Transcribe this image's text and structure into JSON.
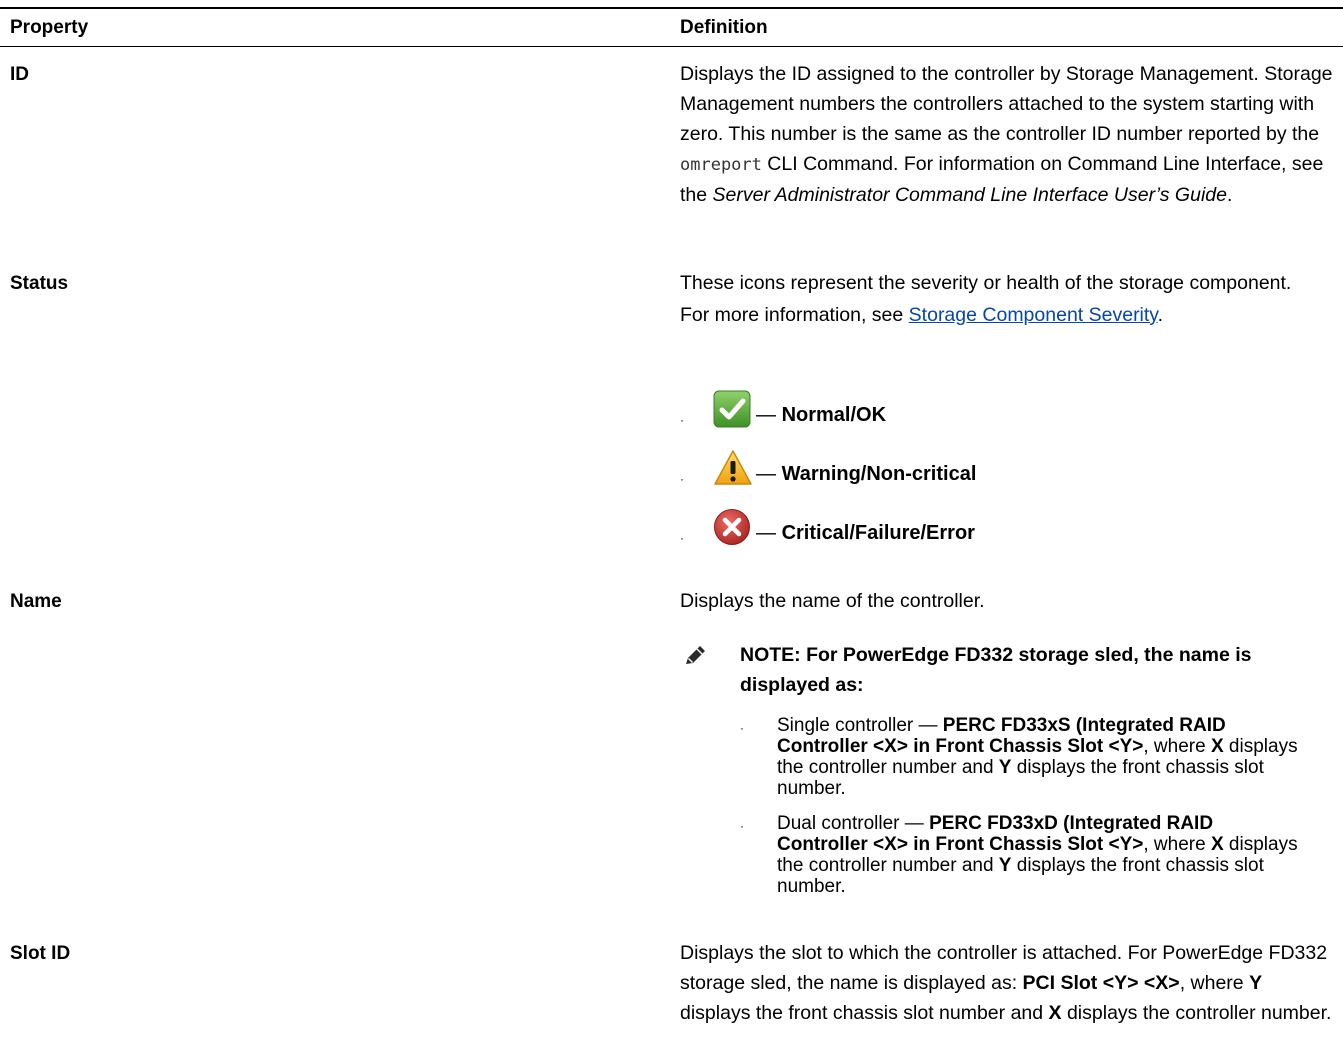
{
  "table": {
    "header": {
      "property": "Property",
      "definition": "Definition"
    },
    "rows": [
      {
        "property": "ID",
        "def_part1": "Displays the ID assigned to the controller by Storage Management. Storage Management numbers the controllers attached to the system starting with zero. This number is the same as the controller ID number reported by the ",
        "def_code": "omreport",
        "def_part2": " CLI Command. For information on Command Line Interface, see the ",
        "def_guide": "Server Administrator Command Line Interface User’s Guide",
        "def_end": "."
      },
      {
        "property": "Status",
        "def_line1": "These icons represent the severity or health of the storage component.",
        "def_line2_prefix": "For more information, see ",
        "def_link": "Storage Component Severity",
        "def_line2_suffix": ".",
        "icons": [
          {
            "icon": "check-icon",
            "dash": "—",
            "label": "Normal/OK",
            "color": "#5aa83a"
          },
          {
            "icon": "warning-icon",
            "dash": "—",
            "label": "Warning/Non-critical",
            "color": "#f2b01e"
          },
          {
            "icon": "error-icon",
            "dash": "—",
            "label": "Critical/Failure/Error",
            "color": "#c9302c"
          }
        ]
      },
      {
        "property": "Name",
        "def_line1": "Displays the name of the controller.",
        "note": "NOTE: For PowerEdge FD332 storage sled, the name is displayed as:",
        "items": [
          {
            "prefix": "Single controller — ",
            "bold1": "PERC FD33xS (Integrated RAID Controller <X> in Front Chassis Slot <Y>",
            "mid1": ", where ",
            "x": "X",
            "mid2": " displays the controller number and ",
            "y": "Y",
            "end": " displays the front chassis slot number."
          },
          {
            "prefix": "Dual controller — ",
            "bold1": "PERC FD33xD (Integrated RAID Controller <X> in Front Chassis Slot <Y>",
            "mid1": ", where ",
            "x": "X",
            "mid2": " displays the controller number and ",
            "y": "Y",
            "end": " displays the front chassis slot number."
          }
        ]
      },
      {
        "property": "Slot ID",
        "def_part1": "Displays the slot to which the controller is attached. For PowerEdge FD332 storage sled, the name is displayed as: ",
        "def_bold": "PCI Slot <Y> <X>",
        "def_part2": ", where ",
        "y": "Y",
        "def_part3": " displays the front chassis slot number and ",
        "x": "X",
        "def_part4": " displays the controller number."
      }
    ]
  }
}
